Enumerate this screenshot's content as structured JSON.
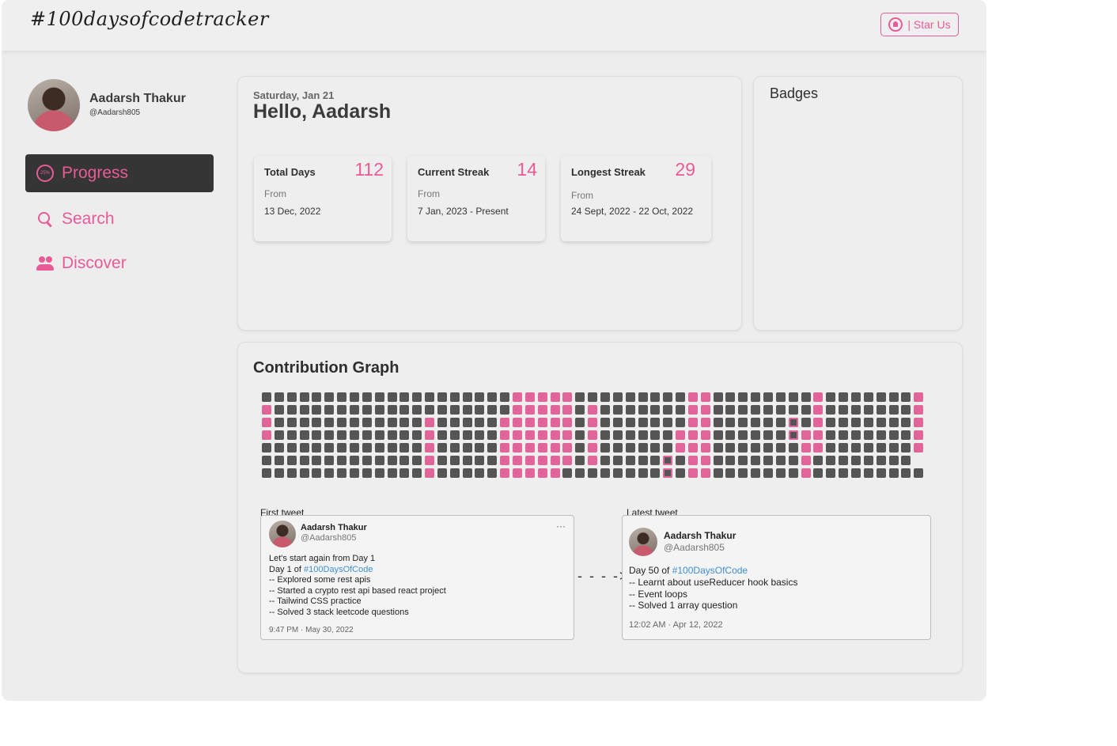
{
  "header": {
    "logo": "#100daysofcodetracker",
    "star_label": "| Star Us"
  },
  "profile": {
    "name": "Aadarsh Thakur",
    "handle": "@Aadarsh805"
  },
  "nav": [
    {
      "label": "Progress",
      "icon": "progress-ring-icon",
      "badge": "25%",
      "active": true
    },
    {
      "label": "Search",
      "icon": "search-icon",
      "active": false
    },
    {
      "label": "Discover",
      "icon": "people-icon",
      "active": false
    }
  ],
  "summary": {
    "date": "Saturday, Jan 21",
    "greeting": "Hello, Aadarsh",
    "stats": [
      {
        "title": "Total Days",
        "value": "112",
        "from_label": "From",
        "range": "13 Dec, 2022"
      },
      {
        "title": "Current Streak",
        "value": "14",
        "from_label": "From",
        "range": "7 Jan, 2023 - Present"
      },
      {
        "title": "Longest Streak",
        "value": "29",
        "from_label": "From",
        "range": "24 Sept, 2022  - 22 Oct, 2022"
      }
    ]
  },
  "badges": {
    "title": "Badges"
  },
  "graph": {
    "title": "Contribution Graph",
    "columns": 53,
    "rows": 7,
    "active_cells": [
      [
        0,
        1
      ],
      [
        0,
        2
      ],
      [
        0,
        3
      ],
      [
        13,
        2
      ],
      [
        13,
        3
      ],
      [
        13,
        4
      ],
      [
        13,
        5
      ],
      [
        13,
        6
      ],
      [
        19,
        2
      ],
      [
        19,
        3
      ],
      [
        19,
        4
      ],
      [
        19,
        5
      ],
      [
        19,
        6
      ],
      [
        20,
        0
      ],
      [
        20,
        1
      ],
      [
        20,
        2
      ],
      [
        20,
        3
      ],
      [
        20,
        4
      ],
      [
        20,
        5
      ],
      [
        20,
        6
      ],
      [
        21,
        0
      ],
      [
        21,
        1
      ],
      [
        21,
        2
      ],
      [
        21,
        3
      ],
      [
        21,
        4
      ],
      [
        21,
        5
      ],
      [
        21,
        6
      ],
      [
        22,
        0
      ],
      [
        22,
        1
      ],
      [
        22,
        2
      ],
      [
        22,
        3
      ],
      [
        22,
        4
      ],
      [
        22,
        5
      ],
      [
        22,
        6
      ],
      [
        23,
        0
      ],
      [
        23,
        1
      ],
      [
        23,
        2
      ],
      [
        23,
        3
      ],
      [
        23,
        4
      ],
      [
        23,
        5
      ],
      [
        23,
        6
      ],
      [
        24,
        0
      ],
      [
        24,
        1
      ],
      [
        24,
        2
      ],
      [
        24,
        3
      ],
      [
        24,
        4
      ],
      [
        24,
        5
      ],
      [
        26,
        1
      ],
      [
        26,
        2
      ],
      [
        26,
        3
      ],
      [
        26,
        4
      ],
      [
        26,
        5
      ],
      [
        33,
        3
      ],
      [
        33,
        4
      ],
      [
        34,
        0
      ],
      [
        34,
        1
      ],
      [
        34,
        2
      ],
      [
        34,
        3
      ],
      [
        34,
        4
      ],
      [
        34,
        5
      ],
      [
        34,
        6
      ],
      [
        35,
        0
      ],
      [
        35,
        1
      ],
      [
        35,
        2
      ],
      [
        35,
        3
      ],
      [
        35,
        4
      ],
      [
        35,
        5
      ],
      [
        35,
        6
      ],
      [
        43,
        3
      ],
      [
        43,
        4
      ],
      [
        43,
        5
      ],
      [
        43,
        6
      ],
      [
        44,
        0
      ],
      [
        44,
        1
      ],
      [
        44,
        2
      ],
      [
        44,
        3
      ],
      [
        44,
        4
      ],
      [
        52,
        0
      ],
      [
        52,
        1
      ],
      [
        52,
        2
      ],
      [
        52,
        3
      ],
      [
        52,
        4
      ]
    ],
    "highlighted_cells": [
      [
        32,
        5
      ],
      [
        32,
        6
      ],
      [
        42,
        2
      ],
      [
        42,
        3
      ]
    ]
  },
  "tweets": {
    "first": {
      "label": "First tweet",
      "name": "Aadarsh Thakur",
      "handle": "@Aadarsh805",
      "line1": "Let's start again from Day 1",
      "line2_prefix": "Day 1 of ",
      "hashtag": "#100DaysOfCode",
      "lines": [
        "-- Explored some rest apis",
        "-- Started a crypto rest api based react project",
        "-- Tailwind CSS practice",
        "-- Solved 3 stack leetcode questions"
      ],
      "time": "9:47 PM · May 30, 2022",
      "more": "···"
    },
    "latest": {
      "label": "Latest tweet",
      "name": "Aadarsh Thakur",
      "handle": "@Aadarsh805",
      "line2_prefix": "Day 50 of ",
      "hashtag": "#100DaysOfCode",
      "lines": [
        "-- Learnt about useReducer hook basics",
        "-- Event loops",
        "-- Solved 1 array question"
      ],
      "time": "12:02 AM · Apr 12, 2022"
    },
    "arrow": "- - - ->"
  },
  "colors": {
    "accent": "#e95b97",
    "cell_inactive": "#555555",
    "cell_active": "#e0669a",
    "hashtag": "#3d8fd6"
  }
}
